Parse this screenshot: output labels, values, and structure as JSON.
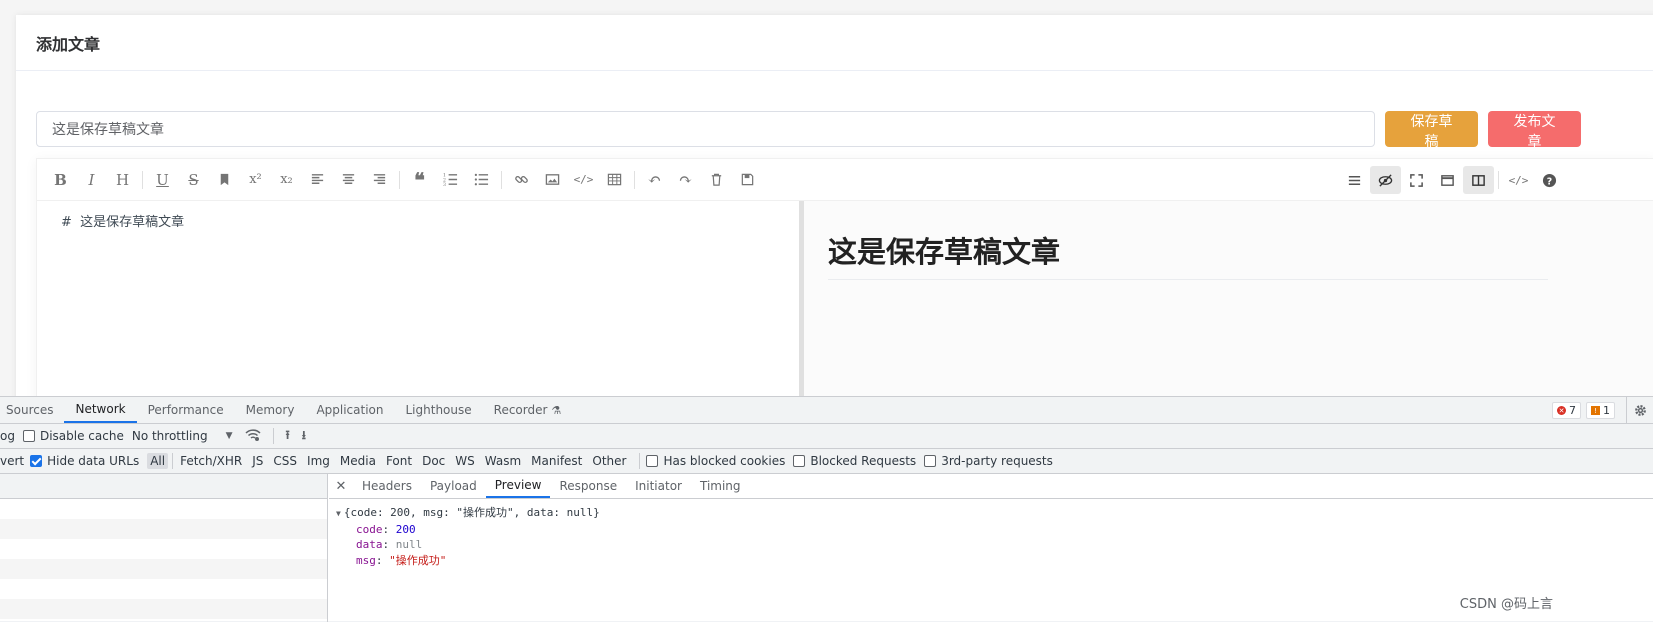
{
  "page": {
    "title": "添加文章",
    "article_title_value": "这是保存草稿文章",
    "buttons": {
      "save_draft": "保存草稿",
      "publish": "发布文章"
    }
  },
  "editor": {
    "toolbar_left": [
      "bold-icon",
      "italic-icon",
      "heading-icon",
      "underline-icon",
      "strikethrough-icon",
      "mark-icon",
      "superscript-icon",
      "subscript-icon",
      "align-left-icon",
      "align-center-icon",
      "align-right-icon",
      "quote-icon",
      "ordered-list-icon",
      "unordered-list-icon",
      "link-icon",
      "image-icon",
      "code-icon",
      "table-icon",
      "undo-icon",
      "redo-icon",
      "trash-icon",
      "save-icon"
    ],
    "toolbar_right": [
      "navigation-icon",
      "preview-toggle-icon",
      "fullscreen-icon",
      "read-mode-icon",
      "subfield-icon",
      "html-code-icon",
      "help-icon"
    ],
    "markdown_source": "#  这是保存草稿文章",
    "preview_heading": "这是保存草稿文章"
  },
  "devtools": {
    "tabs": [
      "Sources",
      "Network",
      "Performance",
      "Memory",
      "Application",
      "Lighthouse",
      "Recorder"
    ],
    "active_tab": "Network",
    "errors_count": "7",
    "warnings_count": "1",
    "toolbar": {
      "preserve_log_tail": "og",
      "disable_cache": "Disable cache",
      "throttling": "No throttling"
    },
    "filter_bar": {
      "invert_tail": "vert",
      "hide_data_urls": "Hide data URLs",
      "types": [
        "All",
        "Fetch/XHR",
        "JS",
        "CSS",
        "Img",
        "Media",
        "Font",
        "Doc",
        "WS",
        "Wasm",
        "Manifest",
        "Other"
      ],
      "has_blocked_cookies": "Has blocked cookies",
      "blocked_requests": "Blocked Requests",
      "third_party": "3rd-party requests"
    },
    "detail_tabs": [
      "Headers",
      "Payload",
      "Preview",
      "Response",
      "Initiator",
      "Timing"
    ],
    "active_detail_tab": "Preview",
    "preview": {
      "summary": "{code: 200, msg: \"操作成功\", data: null}",
      "code_key": "code",
      "code_val": "200",
      "data_key": "data",
      "data_val": "null",
      "msg_key": "msg",
      "msg_val": "\"操作成功\""
    }
  },
  "watermark": "CSDN @码上言"
}
